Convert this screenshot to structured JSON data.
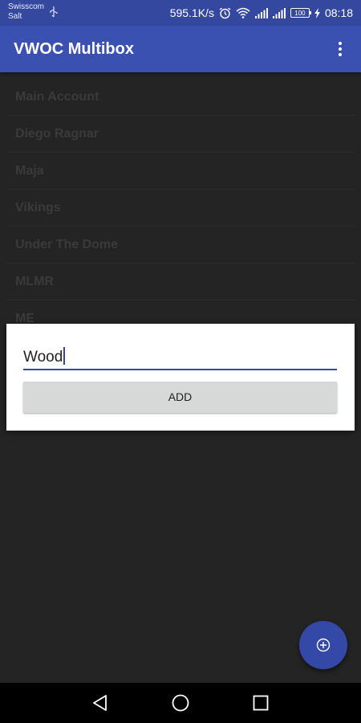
{
  "status_bar": {
    "carrier_line1": "Swisscom",
    "carrier_line2": "Salt",
    "network_speed": "595.1K/s",
    "battery_level": "100",
    "time": "08:18",
    "icons": [
      "usb-icon",
      "alarm-icon",
      "wifi-icon",
      "signal-icon",
      "signal-icon",
      "battery-icon",
      "charging-icon"
    ]
  },
  "app_bar": {
    "title": "VWOC Multibox",
    "menu_icon": "more-vert-icon"
  },
  "accounts": [
    {
      "label": "Main Account"
    },
    {
      "label": "Diego Ragnar"
    },
    {
      "label": "Maja"
    },
    {
      "label": "Vikings"
    },
    {
      "label": "Under The Dome"
    },
    {
      "label": "MLMR"
    },
    {
      "label": "ME"
    }
  ],
  "dialog": {
    "input_value": "Wood",
    "add_label": "ADD"
  },
  "fab": {
    "icon": "add-circle-icon"
  },
  "nav_bar": {
    "icons": [
      "back-icon",
      "home-icon",
      "recents-icon"
    ]
  },
  "colors": {
    "primary": "#3b51b2",
    "status_bar": "#3448a0",
    "scrim_background": "#242424",
    "dialog_background": "#ffffff",
    "button_background": "#d7d8d8"
  }
}
